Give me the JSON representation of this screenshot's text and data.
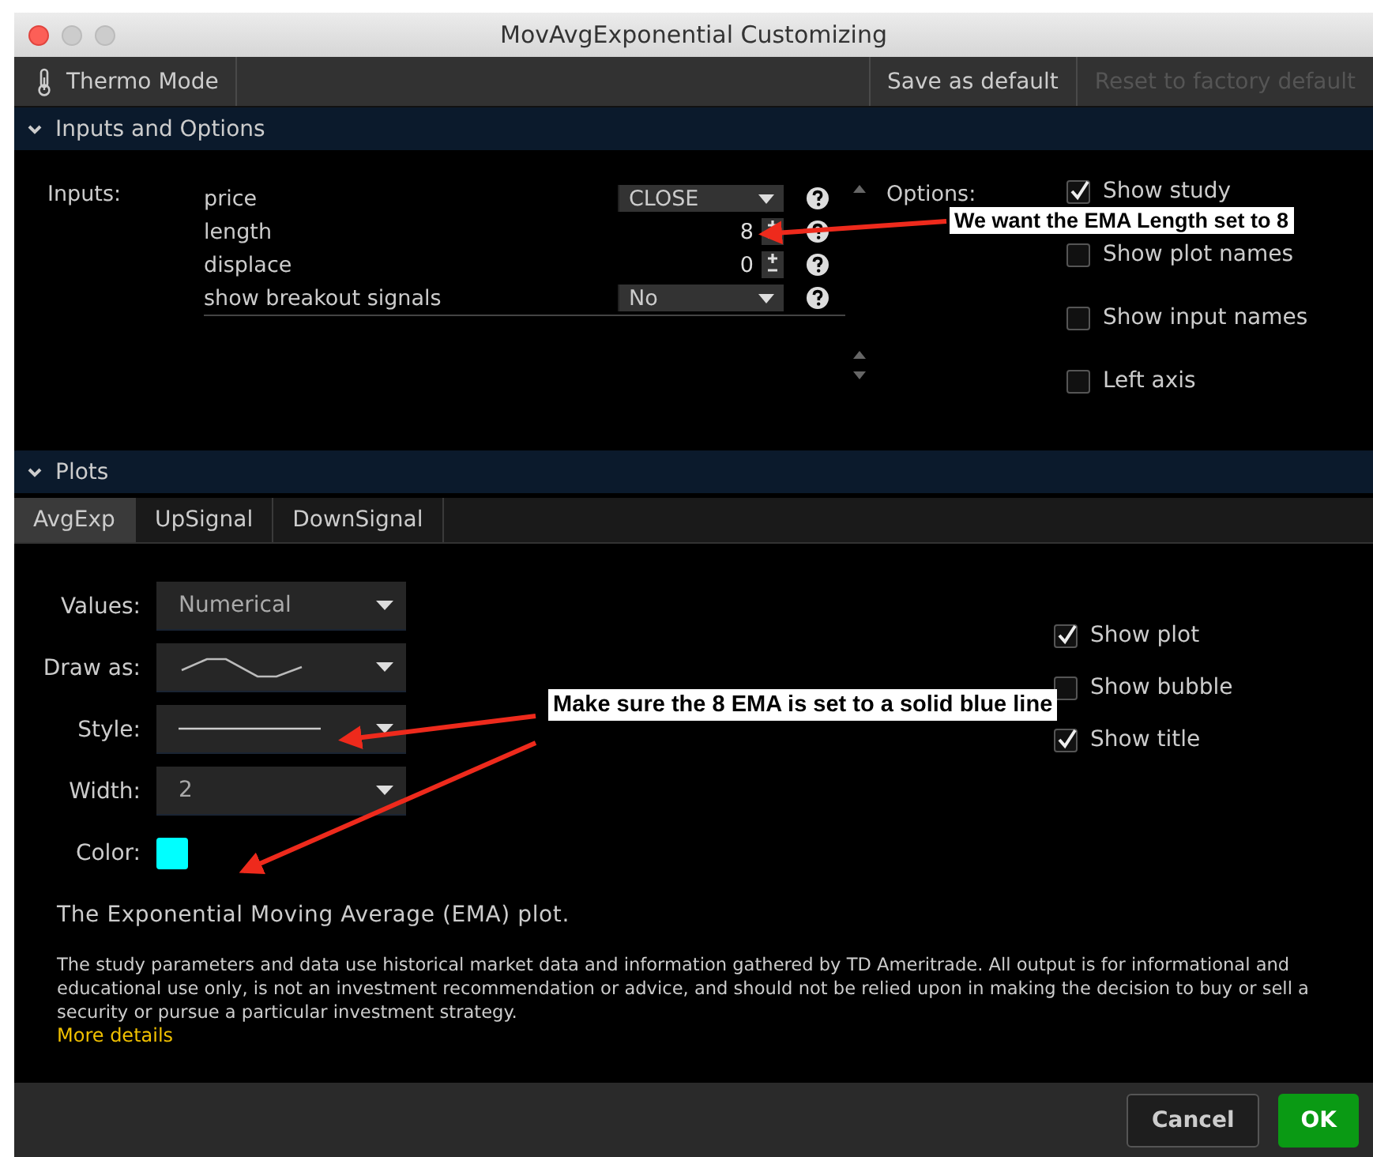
{
  "window": {
    "title": "MovAvgExponential Customizing"
  },
  "toolbar": {
    "thermo_mode": "Thermo Mode",
    "save_default": {
      "label": "Save as default",
      "disabled": false
    },
    "reset_default": {
      "label": "Reset to factory default",
      "disabled": true
    }
  },
  "inputs_section": {
    "title": "Inputs and Options",
    "expanded": true,
    "label": "Inputs:",
    "inputs": [
      {
        "name": "price",
        "kind": "dropdown",
        "value": "CLOSE"
      },
      {
        "name": "length",
        "kind": "spinner",
        "value": "8"
      },
      {
        "name": "displace",
        "kind": "spinner",
        "value": "0"
      },
      {
        "name": "show breakout signals",
        "kind": "dropdown",
        "value": "No"
      }
    ],
    "options_label": "Options:",
    "options": [
      {
        "label": "Show study",
        "checked": true
      },
      {
        "label": "Show plot names",
        "checked": false
      },
      {
        "label": "Show input names",
        "checked": false
      },
      {
        "label": "Left axis",
        "checked": false
      }
    ]
  },
  "plots_section": {
    "title": "Plots",
    "expanded": true,
    "tabs": [
      {
        "label": "AvgExp",
        "selected": true
      },
      {
        "label": "UpSignal",
        "selected": false
      },
      {
        "label": "DownSignal",
        "selected": false
      }
    ],
    "fields": [
      {
        "label": "Values:",
        "kind": "dropdown",
        "value": "Numerical"
      },
      {
        "label": "Draw as:",
        "kind": "curve"
      },
      {
        "label": "Style:",
        "kind": "line"
      },
      {
        "label": "Width:",
        "kind": "dropdown",
        "value": "2"
      },
      {
        "label": "Color:",
        "kind": "color",
        "color": "#00ffff"
      }
    ],
    "options": [
      {
        "label": "Show plot",
        "checked": true
      },
      {
        "label": "Show bubble",
        "checked": false
      },
      {
        "label": "Show title",
        "checked": true
      }
    ],
    "description": "The Exponential Moving Average (EMA) plot.",
    "disclaimer": "The study parameters and data use historical market data and information gathered by TD Ameritrade. All output is for informational and educational use only, is not an investment recommendation or advice, and should not be relied upon in making the decision to buy or sell a security or pursue a particular investment strategy.",
    "more_details": "More details"
  },
  "buttons": [
    {
      "label": "Cancel",
      "kind": "secondary"
    },
    {
      "label": "OK",
      "kind": "primary"
    }
  ],
  "annotations": [
    {
      "text": "We want the EMA Length set to 8"
    },
    {
      "text": "Make sure the 8 EMA is set to a solid blue line"
    }
  ]
}
